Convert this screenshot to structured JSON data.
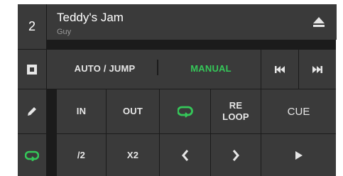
{
  "deck": {
    "number": "2"
  },
  "track": {
    "title": "Teddy's Jam",
    "artist": "Guy"
  },
  "modes": {
    "auto_jump": "AUTO / JUMP",
    "manual": "MANUAL"
  },
  "buttons": {
    "in": "IN",
    "out": "OUT",
    "reloop_line1": "RE",
    "reloop_line2": "LOOP",
    "cue": "CUE",
    "half": "/2",
    "double": "X2"
  },
  "colors": {
    "accent": "#35c759",
    "panel": "#3a3a3a",
    "background": "#1b1b1b"
  },
  "icons": [
    "eject-icon",
    "stop-square-icon",
    "pencil-icon",
    "loop-icon",
    "skip-back-icon",
    "skip-forward-icon",
    "chevron-left-icon",
    "chevron-right-icon",
    "play-icon"
  ]
}
